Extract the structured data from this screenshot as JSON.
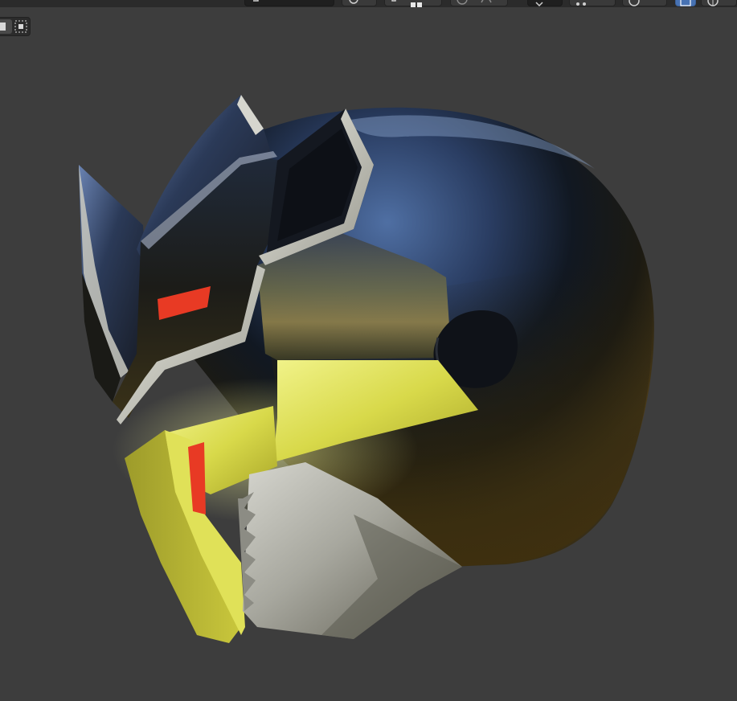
{
  "app": {
    "name": "3D viewport",
    "colors": {
      "viewport_bg": "#3d3d3d",
      "header_bg": "#2b2b2b",
      "accent": "#4772b3",
      "helmet_glow": "#e8ee5a",
      "visor_red": "#e83a24"
    }
  },
  "header": {
    "menus": [
      {
        "id": "view",
        "icon": "none"
      },
      {
        "id": "select",
        "icon": "none"
      },
      {
        "id": "add",
        "icon": "none"
      },
      {
        "id": "object",
        "icon": "none"
      }
    ],
    "buttons": [
      {
        "id": "transform-orientation",
        "icon": "axis-icon"
      },
      {
        "id": "pivot",
        "icon": "pivot-icon"
      },
      {
        "id": "snap",
        "icon": "magnet-icon"
      },
      {
        "id": "proportional",
        "icon": "circle-dot-icon"
      },
      {
        "id": "visibility",
        "icon": "eye-icon"
      },
      {
        "id": "gizmo",
        "icon": "gizmo-icon"
      },
      {
        "id": "overlays",
        "icon": "overlay-icon"
      },
      {
        "id": "xray",
        "icon": "xray-icon"
      },
      {
        "id": "shading-solid",
        "icon": "sphere-solid-icon"
      }
    ]
  },
  "toolbar": {
    "select_mode": [
      {
        "id": "select-box",
        "icon": "select-box-icon"
      },
      {
        "id": "select-dotted",
        "icon": "select-dotted-icon"
      }
    ]
  },
  "object": {
    "type": "helmet",
    "materials": [
      "chrome-mirror",
      "glowing-yellow",
      "brushed-silver",
      "red-emissive"
    ]
  }
}
